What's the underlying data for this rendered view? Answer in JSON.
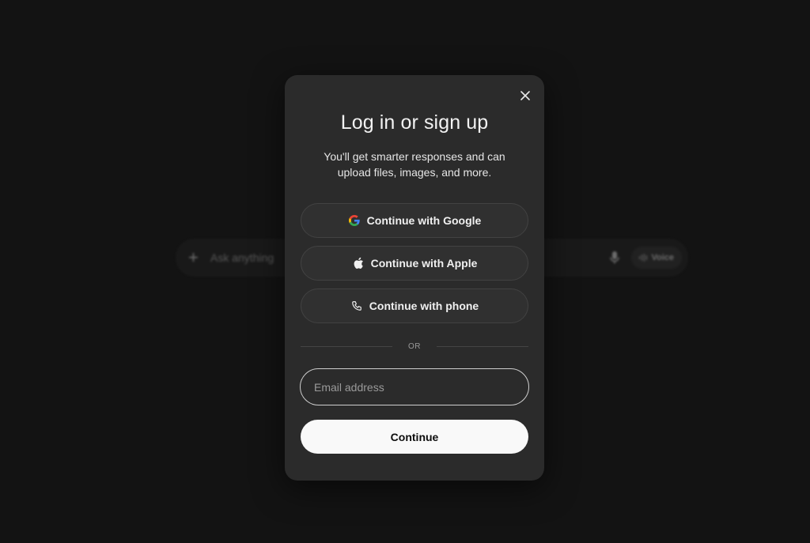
{
  "composer": {
    "plus_icon": "plus-icon",
    "placeholder": "Ask anything",
    "mic_icon": "microphone-icon",
    "voice_label": "Voice",
    "voice_icon": "waveform-icon"
  },
  "modal": {
    "close_icon": "close-icon",
    "title": "Log in or sign up",
    "subtitle": "You'll get smarter responses and can upload files, images, and more.",
    "google_label": "Continue with Google",
    "google_icon": "google-icon",
    "apple_label": "Continue with Apple",
    "apple_icon": "apple-icon",
    "phone_label": "Continue with phone",
    "phone_icon": "phone-icon",
    "divider_text": "OR",
    "email_placeholder": "Email address",
    "email_value": "",
    "continue_label": "Continue"
  },
  "colors": {
    "background": "#131313",
    "modal": "#2b2b2b",
    "button": "#303030",
    "primary_button": "#f9f9f9"
  }
}
